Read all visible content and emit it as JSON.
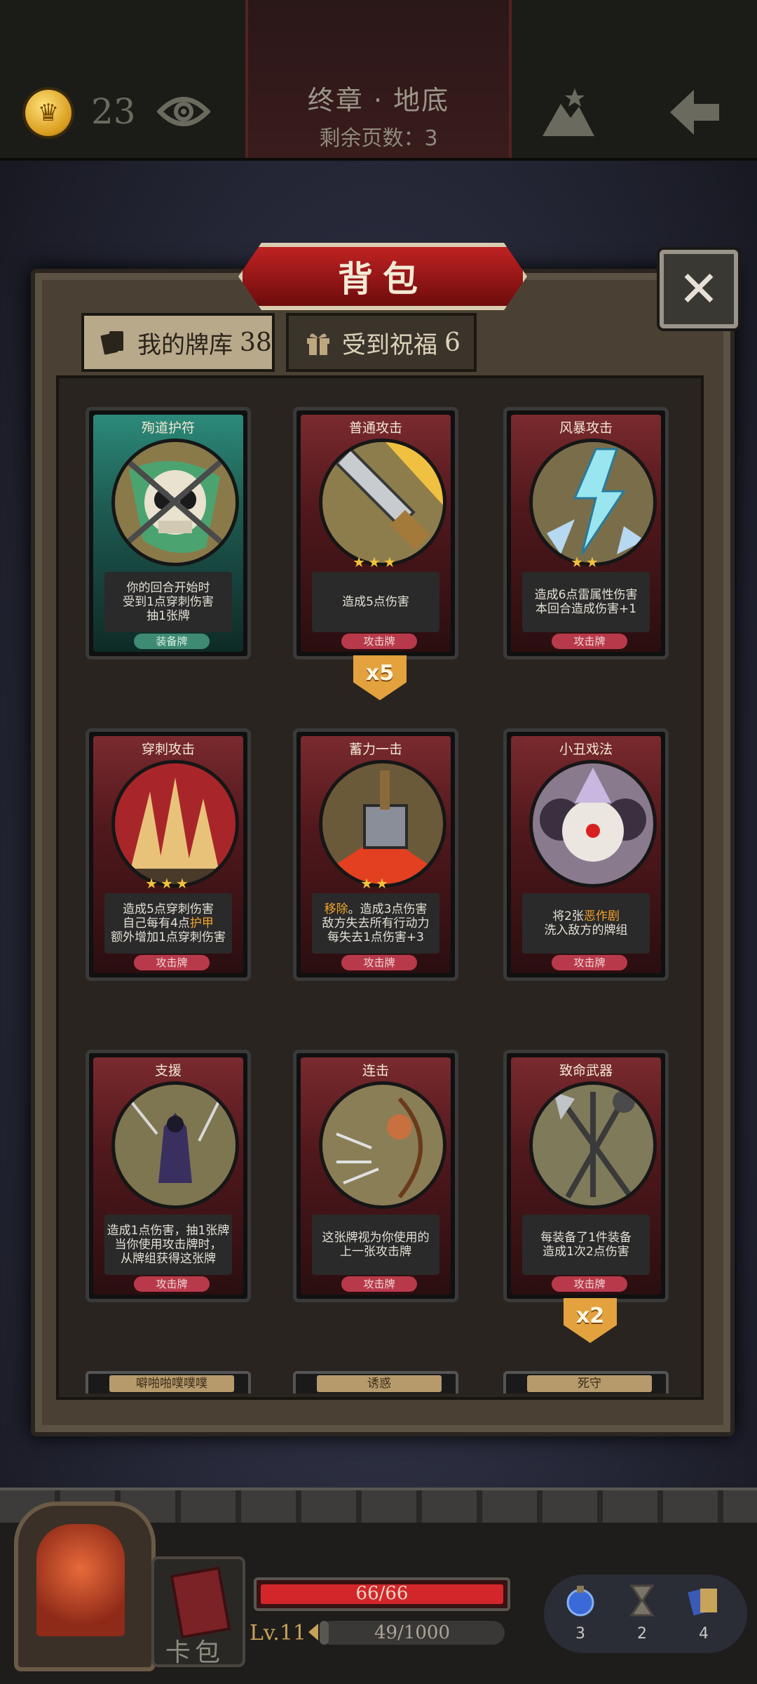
{
  "topbar": {
    "coins": "23",
    "chapter": "终章 · 地底",
    "pages_left": "剩余页数：3"
  },
  "panel": {
    "title": "背包",
    "close": "✕",
    "tabs": [
      {
        "label": "我的牌库",
        "count": "38"
      },
      {
        "label": "受到祝福",
        "count": "6"
      }
    ]
  },
  "cards": [
    {
      "name": "殉道护符",
      "stars": "",
      "desc": "你的回合开始时\n受到1点穿刺伤害\n抽1张牌",
      "type": "装备牌",
      "kind": "equip",
      "count": ""
    },
    {
      "name": "普通攻击",
      "stars": "★★★",
      "desc": "造成5点伤害",
      "type": "攻击牌",
      "kind": "attack",
      "count": "x5"
    },
    {
      "name": "风暴攻击",
      "stars": "★★",
      "desc": "造成6点雷属性伤害\n本回合造成伤害+1",
      "type": "攻击牌",
      "kind": "attack",
      "count": ""
    },
    {
      "name": "穿刺攻击",
      "stars": "★★★",
      "desc": "造成5点穿刺伤害\n自己每有4点护甲\n额外增加1点穿刺伤害",
      "type": "攻击牌",
      "kind": "attack",
      "count": ""
    },
    {
      "name": "蓄力一击",
      "stars": "★★",
      "desc": "移除。造成3点伤害\n敌方失去所有行动力\n每失去1点伤害+3",
      "type": "攻击牌",
      "kind": "attack",
      "count": ""
    },
    {
      "name": "小丑戏法",
      "stars": "",
      "desc": "将2张恶作剧\n洗入敌方的牌组",
      "type": "攻击牌",
      "kind": "attack",
      "count": ""
    },
    {
      "name": "支援",
      "stars": "",
      "desc": "造成1点伤害，抽1张牌\n当你使用攻击牌时，\n从牌组获得这张牌",
      "type": "攻击牌",
      "kind": "attack",
      "count": ""
    },
    {
      "name": "连击",
      "stars": "",
      "desc": "这张牌视为你使用的\n上一张攻击牌",
      "type": "攻击牌",
      "kind": "attack",
      "count": ""
    },
    {
      "name": "致命武器",
      "stars": "",
      "desc": "每装备了1件装备\n造成1次2点伤害",
      "type": "攻击牌",
      "kind": "attack",
      "count": "x2"
    }
  ],
  "peek_cards": [
    "噼啪啪噗噗噗",
    "诱惑",
    "死守"
  ],
  "status": {
    "hp": "66/66",
    "hp_fraction": 1.0,
    "level": "Lv.11",
    "xp": "49/1000",
    "xp_fraction": 0.049,
    "deck_label": "卡包"
  },
  "resources": [
    {
      "icon": "potion-icon",
      "count": "3"
    },
    {
      "icon": "hourglass-icon",
      "count": "2"
    },
    {
      "icon": "cards-icon",
      "count": "4"
    }
  ],
  "colors": {
    "attack_frame": "#7a2a2e",
    "equip_frame": "#2c8a7a",
    "star": "#f3c23c",
    "highlight": "#f0a32a",
    "hp_fill": "#d3262a"
  }
}
